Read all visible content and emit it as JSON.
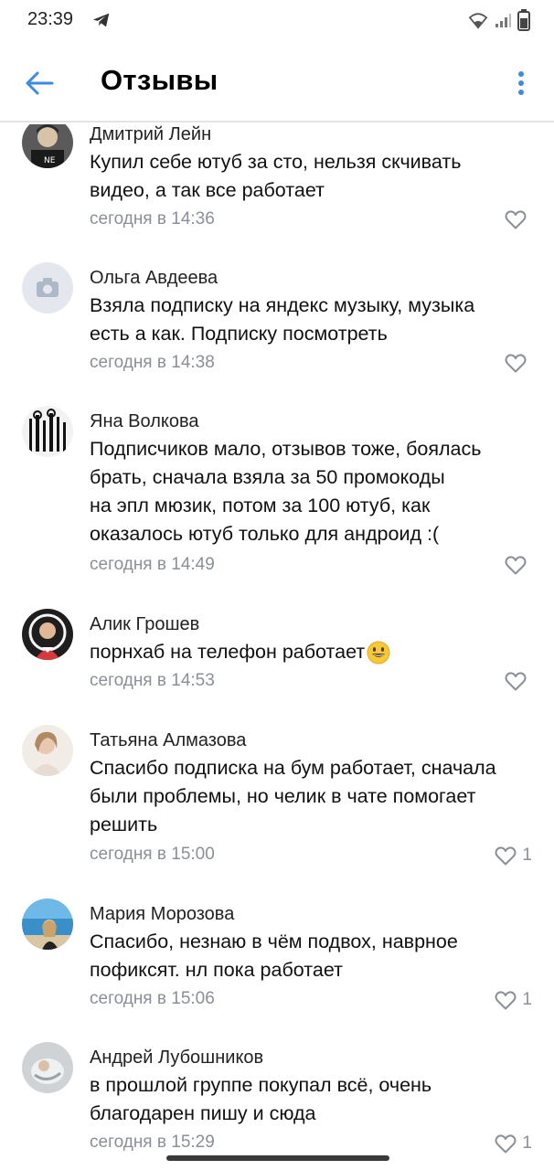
{
  "status_bar": {
    "time": "23:39",
    "icons": [
      "telegram-icon",
      "wifi-icon",
      "signal-icon",
      "battery-icon"
    ]
  },
  "header": {
    "title": "Отзывы",
    "back_icon": "arrow-left-icon",
    "more_icon": "more-vertical-icon",
    "accent_color": "#3f8ae0"
  },
  "reviews": [
    {
      "author": "Дмитрий Лейн",
      "text_lines": [
        "Купил себе ютуб за сто, нельзя скчивать",
        "видео, а так все работает"
      ],
      "time": "сегодня в 14:36",
      "likes": ""
    },
    {
      "author": "Ольга Авдеева",
      "text_lines": [
        "Взяла подписку на яндекс музыку, музыка",
        "есть а как. Подписку посмотреть"
      ],
      "time": "сегодня в 14:38",
      "likes": ""
    },
    {
      "author": "Яна Волкова",
      "text_lines": [
        "Подписчиков мало, отзывов тоже, боялась",
        "брать, сначала взяла за 50 промокоды",
        "на эпл мюзик, потом за 100 ютуб, как",
        "оказалось ютуб только для андроид :("
      ],
      "time": "сегодня в 14:49",
      "likes": ""
    },
    {
      "author": "Алик Грошев",
      "text_lines": [
        "порнхаб на телефон работает"
      ],
      "time": "сегодня в 14:53",
      "likes": ""
    },
    {
      "author": "Татьяна Алмазова",
      "text_lines": [
        "Спасибо подписка на бум работает, сначала",
        "были проблемы, но челик в чате помогает",
        "решить"
      ],
      "time": "сегодня в 15:00",
      "likes": "1"
    },
    {
      "author": "Мария Морозова",
      "text_lines": [
        "Спасибо, незнаю в чём подвох, наврное",
        "пофиксят. нл пока работает"
      ],
      "time": "сегодня в 15:06",
      "likes": "1"
    },
    {
      "author": "Андрей Лубошников",
      "text_lines": [
        "в прошлой группе покупал всё, очень",
        "благодарен пишу и сюда"
      ],
      "time": "сегодня в 15:29",
      "likes": "1"
    }
  ]
}
